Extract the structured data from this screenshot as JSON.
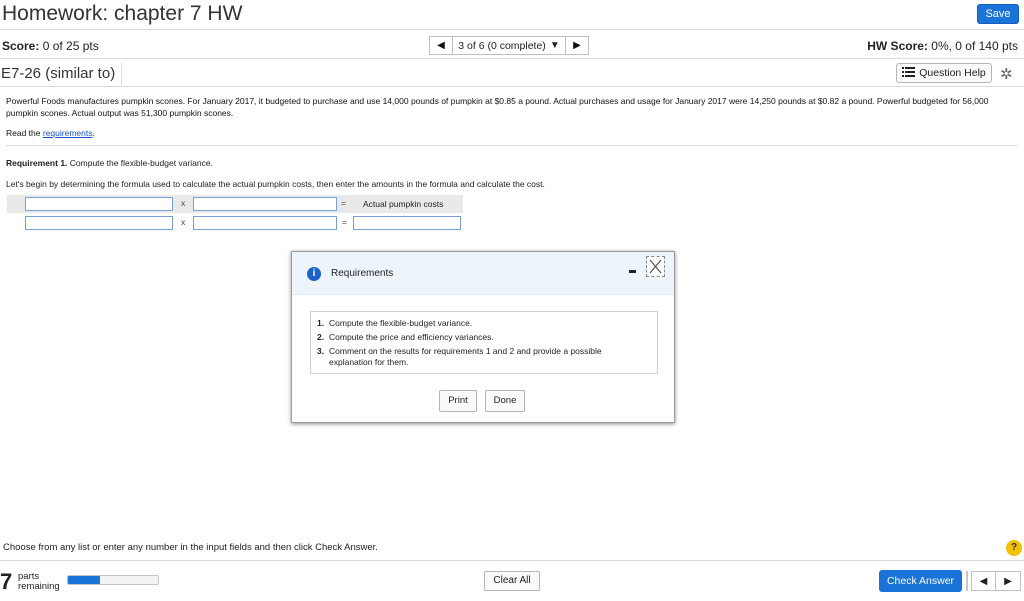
{
  "header": {
    "title": "Homework: chapter 7 HW",
    "save_label": "Save"
  },
  "scorebar": {
    "score_label": "Score:",
    "score_value": "0 of 25 pts",
    "nav_text": "3 of 6 (0 complete)",
    "hw_score_label": "HW Score:",
    "hw_score_value": "0%, 0 of 140 pts"
  },
  "question": {
    "title": "E7-26 (similar to)",
    "help_label": "Question Help"
  },
  "problem": {
    "text": "Powerful Foods manufactures pumpkin scones. For January 2017, it budgeted to purchase and use 14,000 pounds of pumpkin at $0.85 a pound. Actual purchases and usage for January 2017 were 14,250 pounds at $0.82 a pound. Powerful budgeted for 56,000 pumpkin scones. Actual output was 51,300 pumpkin scones.",
    "read_prefix": "Read the",
    "read_link": "requirements",
    "read_suffix": "."
  },
  "requirement": {
    "label": "Requirement 1.",
    "text": "Compute the flexible-budget variance.",
    "instruction": "Let's begin by determining the formula used to calculate the actual pumpkin costs, then enter the amounts in the formula and calculate the cost."
  },
  "formula": {
    "times": "x",
    "equals": "=",
    "result_label": "Actual pumpkin costs"
  },
  "modal": {
    "title": "Requirements",
    "items": [
      {
        "num": "1.",
        "text": "Compute the flexible-budget variance."
      },
      {
        "num": "2.",
        "text": "Compute the price and efficiency variances."
      },
      {
        "num": "3.",
        "text": "Comment on the results for requirements 1 and 2 and provide a possible explanation for them."
      }
    ],
    "print_label": "Print",
    "done_label": "Done"
  },
  "footer": {
    "instruction": "Choose from any list or enter any number in the input fields and then click Check Answer.",
    "parts_count": "7",
    "parts_label_1": "parts",
    "parts_label_2": "remaining",
    "progress_fraction": 0.35,
    "clear_label": "Clear All",
    "check_label": "Check Answer",
    "help_glyph": "?"
  },
  "colors": {
    "accent": "#1a73d9",
    "link": "#1a4fd0",
    "help": "#f2c200"
  },
  "icons": [
    "info-icon",
    "close-icon",
    "minimize-icon",
    "gear-icon",
    "question-list-icon",
    "prev-arrow-icon",
    "next-arrow-icon",
    "dropdown-caret-icon",
    "help-icon"
  ]
}
